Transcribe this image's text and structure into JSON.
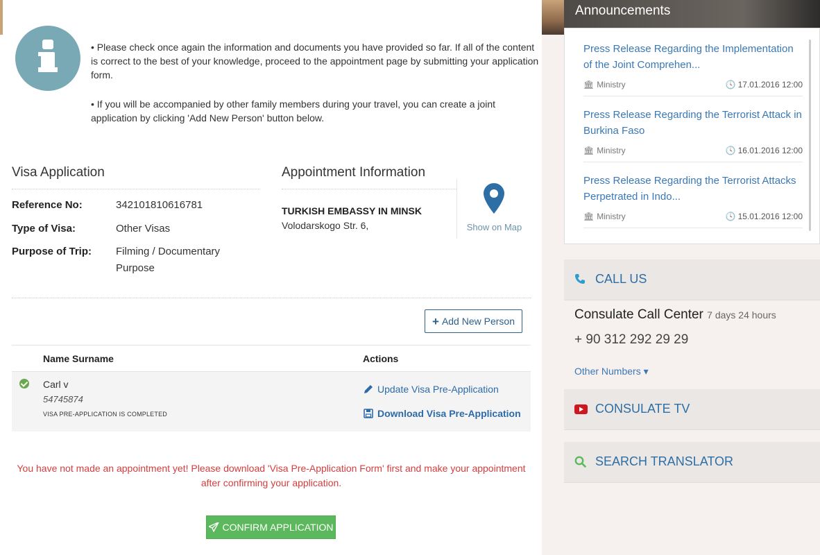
{
  "info": {
    "note1": "• Please check once again the information and documents you have provided so far. If all of the content is correct to the best of your knowledge, proceed to the appointment page by submitting your application form.",
    "note2": "• If you will be accompanied by other family members during your travel, you can create a joint application by clicking 'Add New Person' button below."
  },
  "visa": {
    "title": "Visa Application",
    "reference_label": "Reference No:",
    "reference_value": "342101810616781",
    "type_label": "Type of Visa:",
    "type_value": "Other Visas",
    "purpose_label": "Purpose of Trip:",
    "purpose_value": "Filming / Documentary Purpose"
  },
  "appointment": {
    "title": "Appointment Information",
    "embassy": "TURKISH EMBASSY IN MINSK",
    "address": "Volodarskogo Str. 6,",
    "map_label": "Show on Map"
  },
  "add_person_label": "Add New Person",
  "table": {
    "col_name": "Name Surname",
    "col_actions": "Actions",
    "rows": [
      {
        "name": "Carl v",
        "id": "54745874",
        "status": "VISA PRE-APPLICATION IS COMPLETED",
        "update_label": "Update Visa Pre-Application",
        "download_label": "Download Visa Pre-Application"
      }
    ]
  },
  "warning": "You have not made an appointment yet! Please download 'Visa Pre-Application Form' first and make your appointment after confirming your application.",
  "confirm_label": "CONFIRM APPLICATION",
  "announcements": {
    "title": "Announcements",
    "items": [
      {
        "title": "Press Release Regarding the Implementation of the Joint Comprehen...",
        "source": "Ministry",
        "date": "17.01.2016 12:00"
      },
      {
        "title": "Press Release Regarding the Terrorist Attack in Burkina Faso",
        "source": "Ministry",
        "date": "16.01.2016 12:00"
      },
      {
        "title": "Press Release Regarding the Terrorist Attacks Perpetrated in Indo...",
        "source": "Ministry",
        "date": "15.01.2016 12:00"
      }
    ]
  },
  "call_us": {
    "label": "CALL US",
    "center_title": "Consulate Call Center",
    "center_hours": "7 days 24 hours",
    "phone": "+ 90 312 292 29 29",
    "other_numbers": "Other Numbers"
  },
  "consulate_tv_label": "CONSULATE TV",
  "search_translator_label": "SEARCH TRANSLATOR",
  "colors": {
    "accent_blue": "#2c6aa8",
    "warning_red": "#d43d3d",
    "confirm_green": "#5cb85c",
    "info_circle": "#78a9b5"
  }
}
